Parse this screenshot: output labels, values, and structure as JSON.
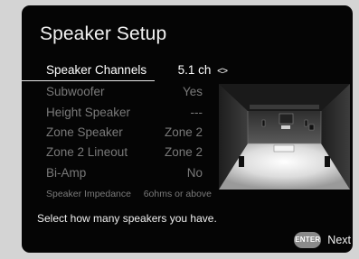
{
  "screen": {
    "title": "Speaker Setup",
    "menu": [
      {
        "label": "Speaker Channels",
        "value": "5.1 ch",
        "arrows": "<>",
        "selected": true
      },
      {
        "label": "Subwoofer",
        "value": "Yes"
      },
      {
        "label": "Height Speaker",
        "value": "---"
      },
      {
        "label": "Zone Speaker",
        "value": "Zone 2"
      },
      {
        "label": "Zone 2 Lineout",
        "value": "Zone 2"
      },
      {
        "label": "Bi-Amp",
        "value": "No"
      },
      {
        "label": "Speaker Impedance",
        "value": "6ohms or above"
      }
    ],
    "hint": "Select how many speakers you have.",
    "footer": {
      "enter_key": "ENTER",
      "next_label": "Next"
    }
  },
  "colors": {
    "background": "#d4d4d4",
    "screen": "#050505",
    "text_selected": "#ffffff",
    "text_dim": "#7a7a7a",
    "enter_badge": "#8a8a8a"
  },
  "icons": {
    "enter": "enter-icon",
    "arrows": "left-right-arrows-icon",
    "room": "speaker-layout-diagram-icon"
  }
}
